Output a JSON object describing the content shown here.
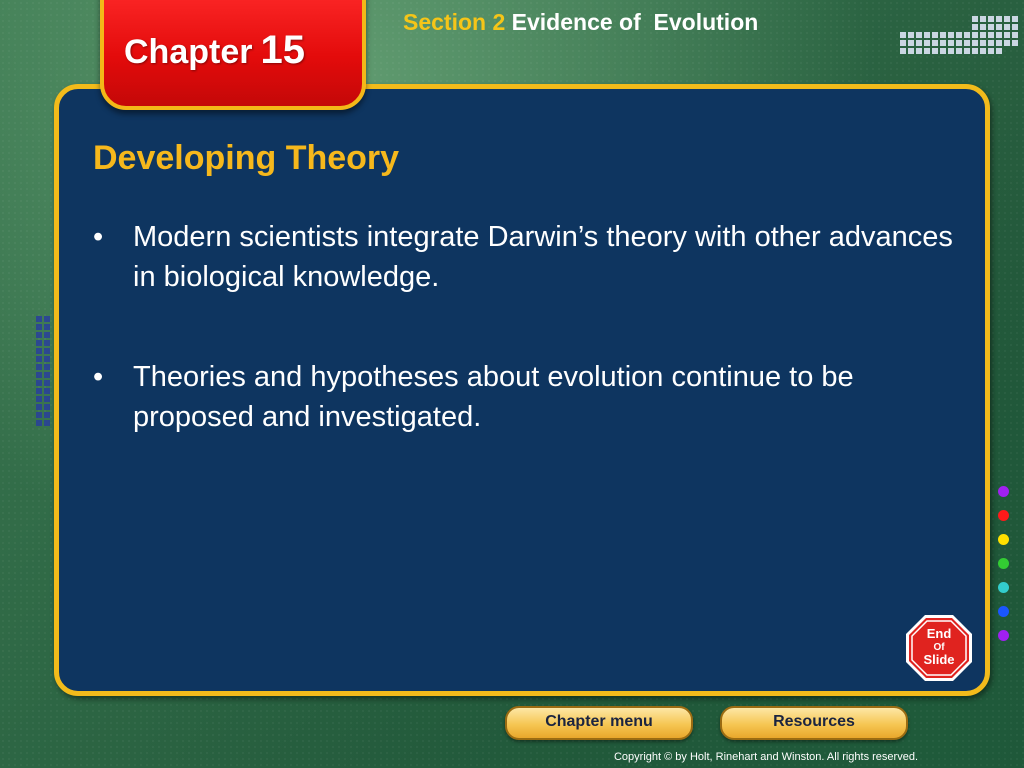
{
  "header": {
    "chapter_label": "Chapter",
    "chapter_number": "15",
    "section_label": "Section 2",
    "section_title": "Evidence of  Evolution"
  },
  "slide": {
    "title": "Developing Theory",
    "bullets": [
      "Modern scientists integrate Darwin’s theory with other advances in biological knowledge.",
      "Theories and hypotheses about evolution continue to be proposed and investigated."
    ]
  },
  "end_slide": {
    "line1": "End",
    "line2": "Of",
    "line3": "Slide",
    "icon": "stop-sign-icon"
  },
  "footer": {
    "chapter_menu_label": "Chapter menu",
    "resources_label": "Resources",
    "copyright": "Copyright © by Holt, Rinehart and Winston. All rights reserved."
  },
  "colors": {
    "accent_gold": "#f2bb1b",
    "panel_blue": "#0e3560",
    "chapter_red": "#e30b0b",
    "dot_colors": [
      "#a020f0",
      "#ff1a1a",
      "#ffe000",
      "#33cc33",
      "#33cccc",
      "#1a56ff",
      "#a020f0"
    ]
  }
}
